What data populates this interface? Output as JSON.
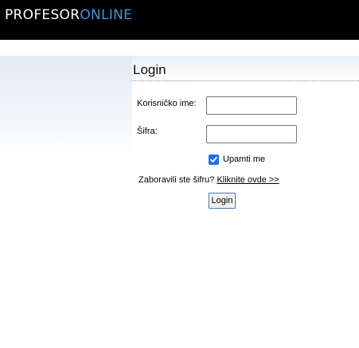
{
  "header": {
    "logo_part1": "PROFESOR",
    "logo_part2": "ONLINE"
  },
  "page": {
    "title": "Login"
  },
  "form": {
    "username_label": "Korisničko ime:",
    "username_value": "",
    "password_label": "Šifra:",
    "password_value": "",
    "remember_label": "Upamti me",
    "remember_checked": true,
    "forgot_text": "Zaboravili ste šifru?",
    "forgot_link": "Kliknite ovde >>",
    "submit_label": "Login"
  },
  "colors": {
    "header_bg": "#000000",
    "logo_accent": "#4a8fd8",
    "checkbox_accent": "#1a73e8"
  }
}
